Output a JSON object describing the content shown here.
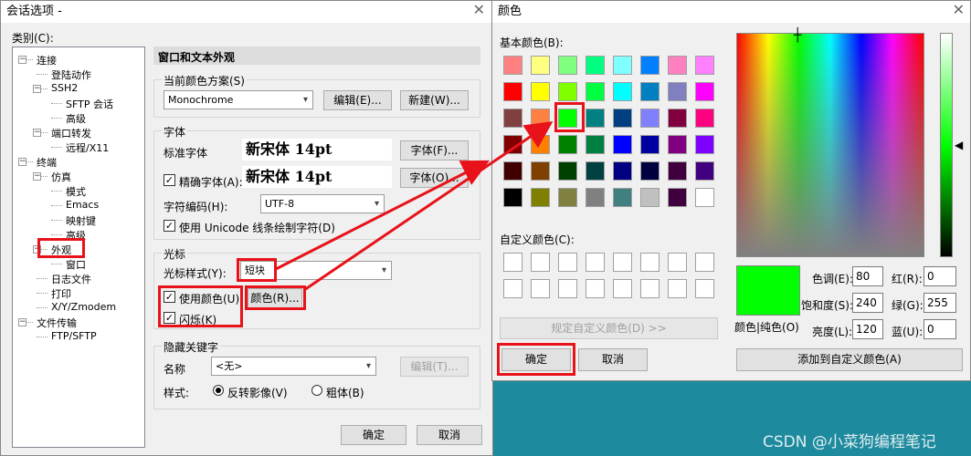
{
  "left_dialog": {
    "title": "会话选项 -",
    "category_label": "类别(C):",
    "tree": [
      {
        "label": "连接",
        "level": 0
      },
      {
        "label": "登陆动作",
        "level": 1
      },
      {
        "label": "SSH2",
        "level": 1
      },
      {
        "label": "SFTP 会话",
        "level": 2
      },
      {
        "label": "高级",
        "level": 2
      },
      {
        "label": "端口转发",
        "level": 1
      },
      {
        "label": "远程/X11",
        "level": 2
      },
      {
        "label": "终端",
        "level": 0
      },
      {
        "label": "仿真",
        "level": 1
      },
      {
        "label": "模式",
        "level": 2
      },
      {
        "label": "Emacs",
        "level": 2
      },
      {
        "label": "映射键",
        "level": 2
      },
      {
        "label": "高级",
        "level": 2
      },
      {
        "label": "外观",
        "level": 1
      },
      {
        "label": "窗口",
        "level": 2
      },
      {
        "label": "日志文件",
        "level": 1
      },
      {
        "label": "打印",
        "level": 1
      },
      {
        "label": "X/Y/Zmodem",
        "level": 1
      },
      {
        "label": "文件传输",
        "level": 0
      },
      {
        "label": "FTP/SFTP",
        "level": 1
      }
    ],
    "panel_title": "窗口和文本外观",
    "scheme_group": "当前颜色方案(S)",
    "scheme_value": "Monochrome",
    "edit_button": "编辑(E)...",
    "new_button": "新建(W)...",
    "font_group": "字体",
    "std_font_label": "标准字体",
    "std_font_value": "新宋体 14pt",
    "font_button": "字体(F)...",
    "precise_font_label": "精确字体(A):",
    "precise_font_value": "新宋体 14pt",
    "font2_button": "字体(O)...",
    "encoding_label": "字符编码(H):",
    "encoding_value": "UTF-8",
    "unicode_label": "使用 Unicode 线条绘制字符(D)",
    "cursor_group": "光标",
    "cursor_style_label": "光标样式(Y):",
    "cursor_style_value": "短块",
    "use_color_label": "使用颜色(U):",
    "color_button": "颜色(R)...",
    "blink_label": "闪烁(K)",
    "hidden_group": "隐藏关键字",
    "name_label": "名称",
    "name_value": "<无>",
    "edit_t_button": "编辑(T)...",
    "style_label": "样式:",
    "reverse_label": "反转影像(V)",
    "bold_label": "粗体(B)",
    "ok_button": "确定",
    "cancel_button": "取消"
  },
  "color_dialog": {
    "title": "颜色",
    "basic_label": "基本颜色(B):",
    "basic_colors": [
      "#ff8080",
      "#ffff80",
      "#80ff80",
      "#00ff80",
      "#80ffff",
      "#0080ff",
      "#ff80c0",
      "#ff80ff",
      "#ff0000",
      "#ffff00",
      "#80ff00",
      "#00ff40",
      "#00ffff",
      "#0080c0",
      "#8080c0",
      "#ff00ff",
      "#804040",
      "#ff8040",
      "#00ff00",
      "#008080",
      "#004080",
      "#8080ff",
      "#800040",
      "#ff0080",
      "#800000",
      "#ff8000",
      "#008000",
      "#008040",
      "#0000ff",
      "#0000a0",
      "#800080",
      "#8000ff",
      "#400000",
      "#804000",
      "#004000",
      "#004040",
      "#000080",
      "#000040",
      "#400040",
      "#400080",
      "#000000",
      "#808000",
      "#808040",
      "#808080",
      "#408080",
      "#c0c0c0",
      "#400040",
      "#ffffff"
    ],
    "custom_label": "自定义颜色(C):",
    "define_button": "规定自定义颜色(D) >>",
    "ok_button": "确定",
    "cancel_button": "取消",
    "solid_label": "颜色|纯色(O)",
    "hue_label": "色调(E):",
    "hue": "80",
    "sat_label": "饱和度(S):",
    "sat": "240",
    "lum_label": "亮度(L):",
    "lum": "120",
    "red_label": "红(R):",
    "red": "0",
    "green_label": "绿(G):",
    "green": "255",
    "blue_label": "蓝(U):",
    "blue": "0",
    "add_button": "添加到自定义颜色(A)",
    "selected_color": "#00ff00"
  },
  "watermark": "CSDN @小菜狗编程笔记",
  "colors": {
    "highlight": "#e8121a",
    "desktop": "#1e8a9e"
  }
}
